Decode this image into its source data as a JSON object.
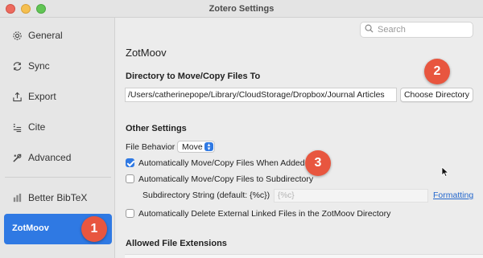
{
  "window": {
    "title": "Zotero Settings"
  },
  "sidebar": {
    "items": [
      {
        "label": "General",
        "icon": "gear-icon"
      },
      {
        "label": "Sync",
        "icon": "sync-icon"
      },
      {
        "label": "Export",
        "icon": "export-icon"
      },
      {
        "label": "Cite",
        "icon": "cite-icon"
      },
      {
        "label": "Advanced",
        "icon": "advanced-icon"
      },
      {
        "label": "Better BibTeX",
        "icon": "bibtex-icon"
      },
      {
        "label": "ZotMoov",
        "selected": true
      }
    ],
    "accent": "#2f79e3"
  },
  "search": {
    "placeholder": "Search"
  },
  "pane": {
    "title": "ZotMoov",
    "directory": {
      "heading": "Directory to Move/Copy Files To",
      "path": "/Users/catherinepope/Library/CloudStorage/Dropbox/Journal Articles",
      "button": "Choose Directory"
    },
    "other": {
      "heading": "Other Settings",
      "file_behavior_label": "File Behavior",
      "file_behavior_value": "Move",
      "auto_move_label": "Automatically Move/Copy Files When Added",
      "auto_move_checked": true,
      "subdir_label": "Automatically Move/Copy Files to Subdirectory",
      "subdir_checked": false,
      "subdir_string_label": "Subdirectory String (default: {%c})",
      "subdir_string_placeholder": "{%c}",
      "formatting_link": "Formatting",
      "auto_delete_label": "Automatically Delete External Linked Files in the ZotMoov Directory",
      "auto_delete_checked": false
    },
    "allowed_heading": "Allowed File Extensions"
  },
  "annotations": {
    "badge1": "1",
    "badge2": "2",
    "badge3": "3",
    "color": "#e8563f"
  }
}
